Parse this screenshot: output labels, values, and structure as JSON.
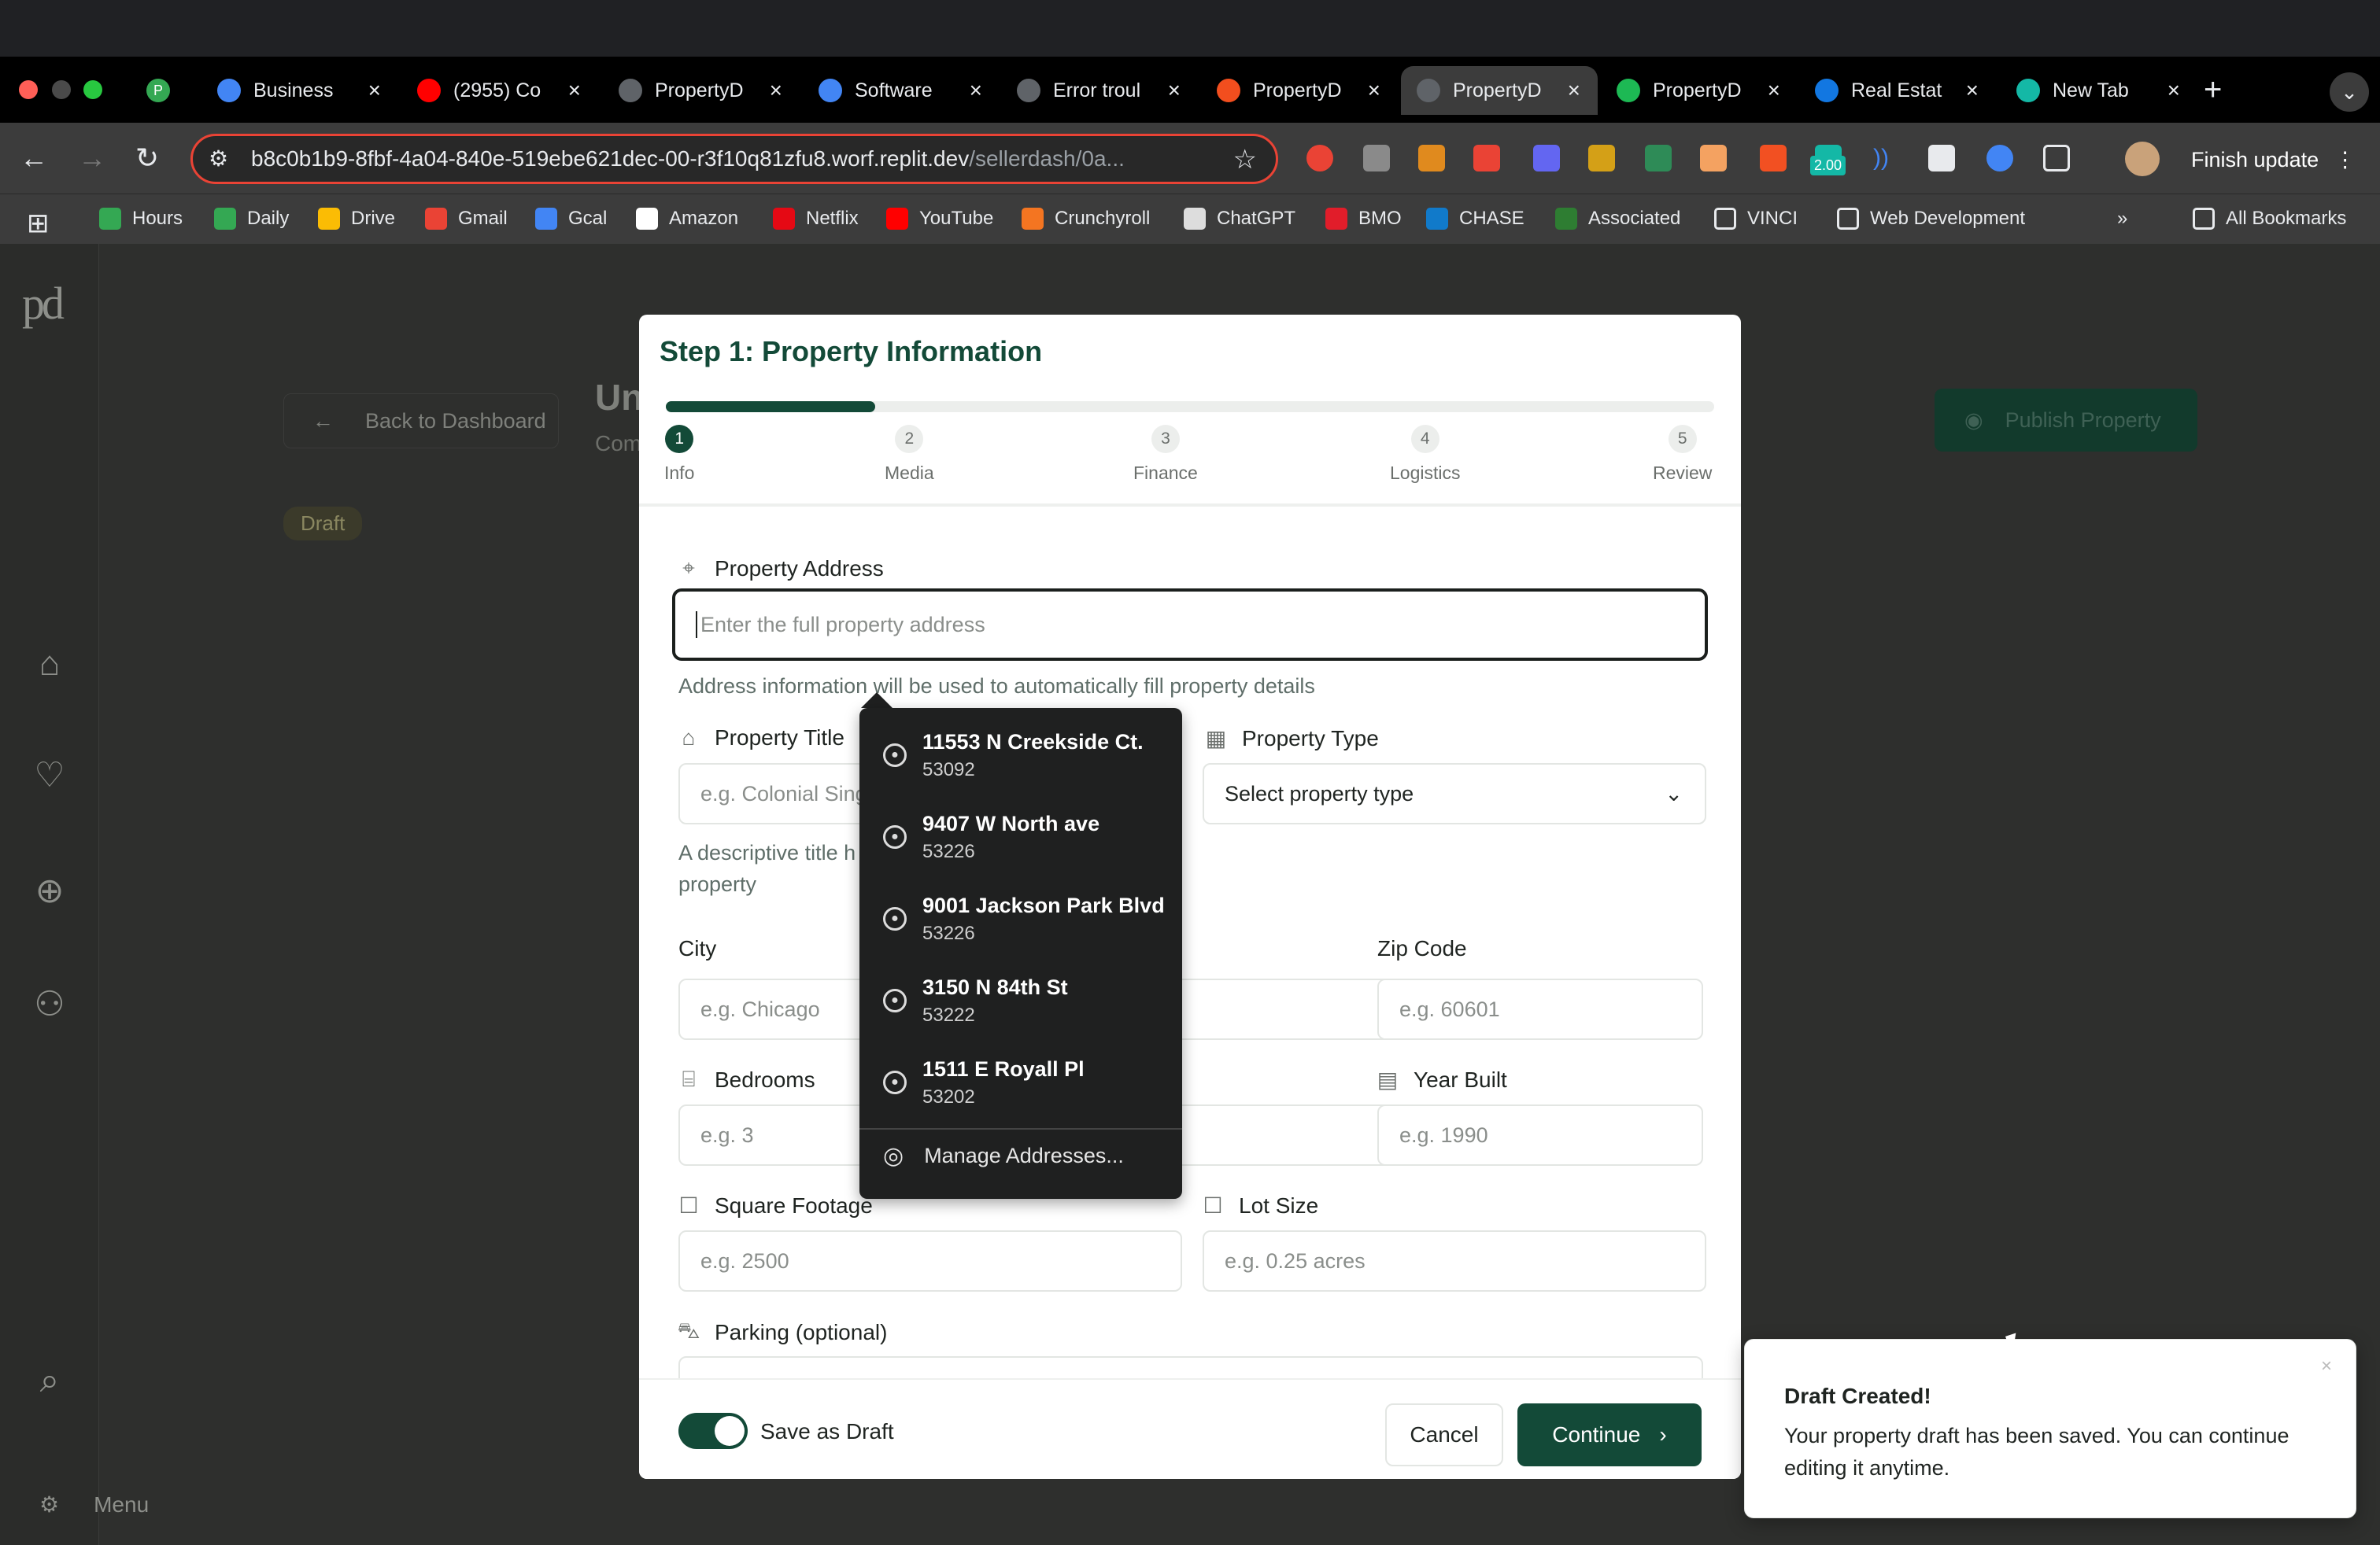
{
  "browser": {
    "tabs": [
      {
        "label": "Business",
        "icon": "docs-icon",
        "color": "#4285f4"
      },
      {
        "label": "(2955) Co",
        "icon": "youtube-icon",
        "color": "#ff0000"
      },
      {
        "label": "PropertyD",
        "icon": "globe-icon",
        "color": "#5f6368"
      },
      {
        "label": "Software",
        "icon": "docs-icon",
        "color": "#4285f4"
      },
      {
        "label": "Error troul",
        "icon": "openai-icon",
        "color": "#5f6368"
      },
      {
        "label": "PropertyD",
        "icon": "figma-icon",
        "color": "#f24e1e"
      },
      {
        "label": "PropertyD",
        "icon": "globe-icon",
        "color": "#5f6368"
      },
      {
        "label": "PropertyD",
        "icon": "bolt-icon",
        "color": "#1db954"
      },
      {
        "label": "Real Estat",
        "icon": "zillow-icon",
        "color": "#1277e1"
      },
      {
        "label": "New Tab",
        "icon": "m-icon",
        "color": "#14b8a6"
      }
    ],
    "url_host": "b8c0b1b9-8fbf-4a04-840e-519ebe621dec-00-r3f10q81zfu8.worf.replit.dev",
    "url_path": "/sellerdash/0a...",
    "finish_update": "Finish update",
    "ext_badge": "2.00",
    "bookmarks": [
      {
        "label": "Hours",
        "color": "#34a853"
      },
      {
        "label": "Daily",
        "color": "#34a853"
      },
      {
        "label": "Drive",
        "color": "#fbbc04"
      },
      {
        "label": "Gmail",
        "color": "#ea4335"
      },
      {
        "label": "Gcal",
        "color": "#4285f4"
      },
      {
        "label": "Amazon",
        "color": "#ffffff"
      },
      {
        "label": "Netflix",
        "color": "#e50914"
      },
      {
        "label": "YouTube",
        "color": "#ff0000"
      },
      {
        "label": "Crunchyroll",
        "color": "#f47521"
      },
      {
        "label": "ChatGPT",
        "color": "#dddddd"
      },
      {
        "label": "BMO",
        "color": "#e11d2a"
      },
      {
        "label": "CHASE",
        "color": "#117aca"
      },
      {
        "label": "Associated",
        "color": "#2e7d32"
      },
      {
        "label": "VINCI",
        "color": "folder"
      },
      {
        "label": "Web Development",
        "color": "folder"
      }
    ],
    "all_bookmarks": "All Bookmarks"
  },
  "app": {
    "logo": "pd",
    "back_label": "Back to Dashboard",
    "bg_title": "Un",
    "bg_subtitle": "Com",
    "status_badge": "Draft",
    "publish_label": "Publish Property",
    "menu_label": "Menu"
  },
  "modal": {
    "title": "Step 1: Property Information",
    "progress": 0.2,
    "steps": [
      {
        "num": "1",
        "label": "Info"
      },
      {
        "num": "2",
        "label": "Media"
      },
      {
        "num": "3",
        "label": "Finance"
      },
      {
        "num": "4",
        "label": "Logistics"
      },
      {
        "num": "5",
        "label": "Review"
      }
    ],
    "address_label": "Property Address",
    "address_placeholder": "Enter the full property address",
    "address_help": "Address information will be used to automatically fill property details",
    "title_label": "Property Title",
    "title_placeholder": "e.g. Colonial Sing",
    "title_help": "A descriptive title h\nproperty",
    "type_label": "Property Type",
    "type_value": "Select property type",
    "city_label": "City",
    "city_placeholder": "e.g. Chicago",
    "zip_label": "Zip Code",
    "zip_placeholder": "e.g. 60601",
    "bedrooms_label": "Bedrooms",
    "bedrooms_placeholder": "e.g. 3",
    "year_label": "Year Built",
    "year_placeholder": "e.g. 1990",
    "sqft_label": "Square Footage",
    "sqft_placeholder": "e.g. 2500",
    "lot_label": "Lot Size",
    "lot_placeholder": "e.g. 0.25 acres",
    "parking_label": "Parking (optional)",
    "draft_label": "Save as Draft",
    "cancel_label": "Cancel",
    "continue_label": "Continue"
  },
  "autocomplete": {
    "items": [
      {
        "address": "11553 N Creekside Ct.",
        "zip": "53092"
      },
      {
        "address": "9407 W North ave",
        "zip": "53226"
      },
      {
        "address": "9001 Jackson Park Blvd",
        "zip": "53226"
      },
      {
        "address": "3150 N 84th St",
        "zip": "53222"
      },
      {
        "address": "1511 E Royall Pl",
        "zip": "53202"
      }
    ],
    "manage": "Manage Addresses..."
  },
  "toast": {
    "title": "Draft Created!",
    "desc": "Your property draft has been saved. You can continue editing it anytime."
  }
}
